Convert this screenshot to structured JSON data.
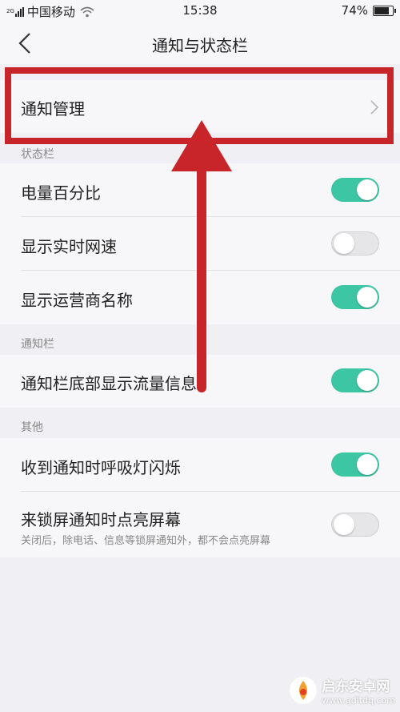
{
  "status_bar": {
    "signal_tag": "2G",
    "carrier": "中国移动",
    "time": "15:38",
    "battery_percent": "74%",
    "battery_level": 0.74
  },
  "nav": {
    "title": "通知与状态栏"
  },
  "notification_management": {
    "label": "通知管理"
  },
  "status_section": {
    "header": "状态栏",
    "items": [
      {
        "label": "电量百分比",
        "on": true
      },
      {
        "label": "显示实时网速",
        "on": false
      },
      {
        "label": "显示运营商名称",
        "on": true
      }
    ]
  },
  "notification_section": {
    "header": "通知栏",
    "items": [
      {
        "label": "通知栏底部显示流量信息",
        "on": true
      }
    ]
  },
  "other_section": {
    "header": "其他",
    "items": [
      {
        "label": "收到通知时呼吸灯闪烁",
        "on": true
      },
      {
        "label": "来锁屏通知时点亮屏幕",
        "sub": "关闭后，除电话、信息等锁屏通知外，都不会点亮屏幕",
        "on": false
      }
    ]
  },
  "watermark": {
    "main": "启东安卓网",
    "sub": "www.qdltdq.com"
  },
  "colors": {
    "toggle_on": "#3cc6a4",
    "toggle_off": "#e6e6e8",
    "annotation_red": "#c8252b"
  }
}
